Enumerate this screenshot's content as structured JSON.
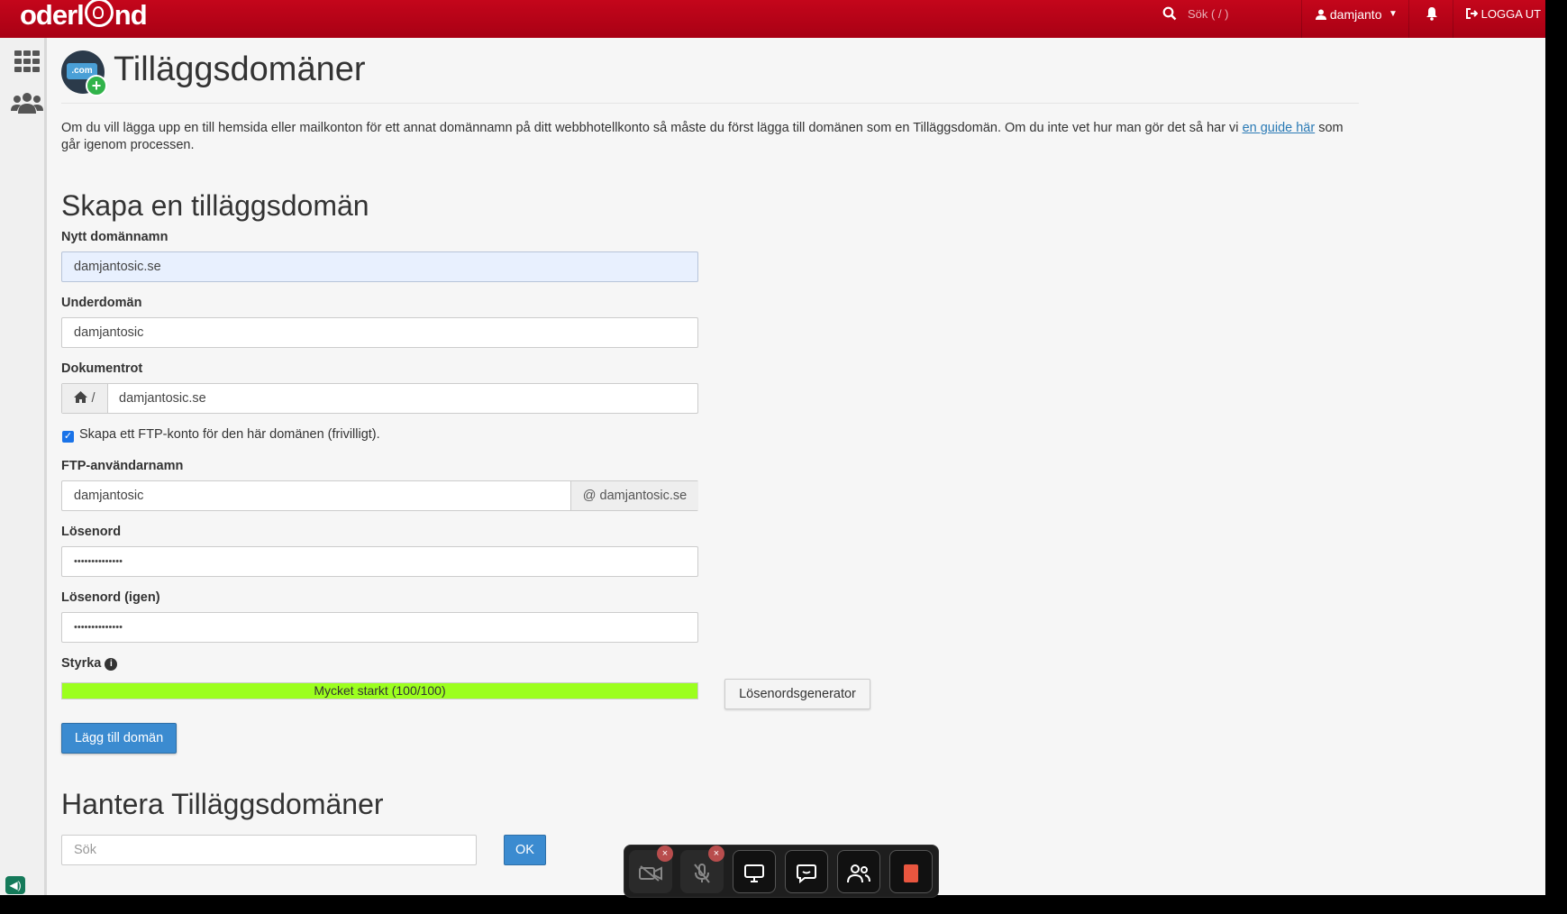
{
  "topbar": {
    "logo": "oderland",
    "search_placeholder": "Sök ( / )",
    "username": "damjanto",
    "logout_label": "LOGGA UT"
  },
  "page": {
    "title": "Tilläggsdomäner",
    "icon_label": ".com",
    "intro_text": "Om du vill lägga upp en till hemsida eller mailkonton för ett annat domännamn på ditt webbhotellkonto så måste du först lägga till domänen som en Tilläggsdomän. Om du inte vet hur man gör det så har vi ",
    "intro_link": "en guide här",
    "intro_tail": " som går igenom processen."
  },
  "create_form": {
    "heading": "Skapa en tilläggsdomän",
    "domain_label": "Nytt domännamn",
    "domain_value": "damjantosic.se",
    "subdomain_label": "Underdomän",
    "subdomain_value": "damjantosic",
    "docroot_label": "Dokumentrot",
    "docroot_prefix": "/",
    "docroot_value": "damjantosic.se",
    "ftp_checkbox_label": "Skapa ett FTP-konto för den här domänen (frivilligt).",
    "ftp_checkbox_checked": true,
    "ftp_user_label": "FTP-användarnamn",
    "ftp_user_value": "damjantosic",
    "ftp_user_suffix": "@ damjantosic.se",
    "password_label": "Lösenord",
    "password_value": "••••••••••••••",
    "password2_label": "Lösenord (igen)",
    "password2_value": "••••••••••••••",
    "strength_label": "Styrka",
    "strength_text": "Mycket starkt (100/100)",
    "strength_percent": 100,
    "generator_button": "Lösenordsgenerator",
    "submit_button": "Lägg till domän"
  },
  "manage": {
    "heading": "Hantera Tilläggsdomäner",
    "search_placeholder": "Sök",
    "ok_button": "OK"
  },
  "colors": {
    "brand_red": "#b8001a",
    "primary_blue": "#3b8bd0",
    "strength_green": "#9cff1e"
  }
}
